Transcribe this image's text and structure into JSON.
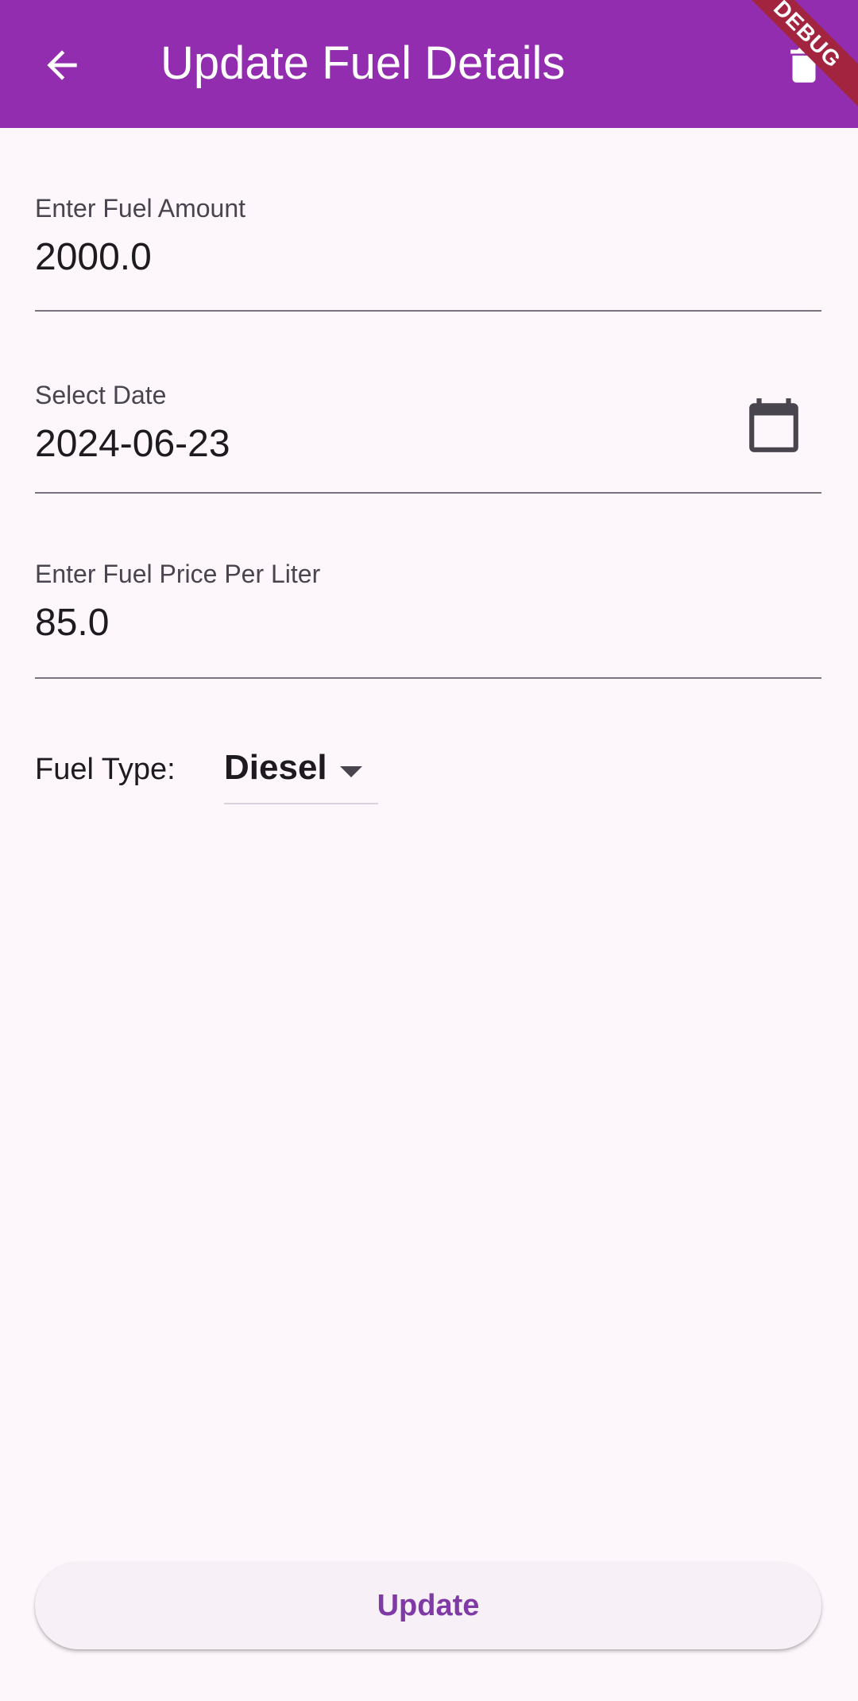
{
  "app_bar": {
    "title": "Update Fuel Details",
    "back_icon": "arrow-back-icon",
    "delete_icon": "trash-icon",
    "debug_banner": "DEBUG",
    "background": "#922db0"
  },
  "form": {
    "fuel_amount": {
      "label": "Enter Fuel Amount",
      "value": "2000.0"
    },
    "date": {
      "label": "Select Date",
      "value": "2024-06-23",
      "icon": "calendar-icon"
    },
    "price_per_liter": {
      "label": "Enter Fuel Price Per Liter",
      "value": "85.0"
    },
    "fuel_type": {
      "label": "Fuel Type:",
      "selected": "Diesel",
      "icon": "dropdown-arrow-icon"
    }
  },
  "actions": {
    "update_label": "Update"
  },
  "colors": {
    "accent": "#922db0",
    "button_text": "#7f3aa6",
    "background": "#fdf7fc"
  }
}
